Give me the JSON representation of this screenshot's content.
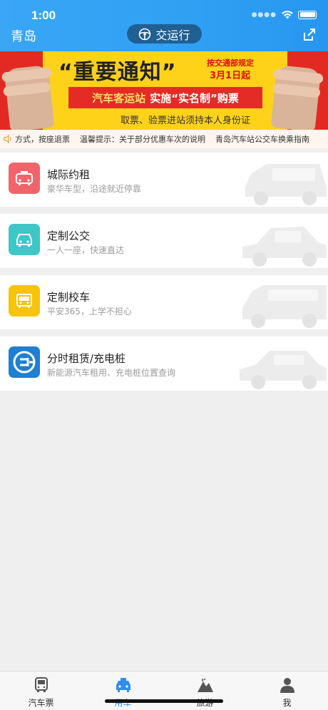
{
  "status_bar": {
    "time": "1:00"
  },
  "header": {
    "city": "青岛",
    "traffic_label": "交运行"
  },
  "banner": {
    "title": "“重要通知”",
    "note_line1": "按交通部规定",
    "note_line2": "3月1日起",
    "ribbon_left": "汽车客运站",
    "ribbon_mid": "实施“实名制”购票",
    "subtitle": "取票、验票进站须持本人身份证"
  },
  "marquee": {
    "items": [
      "方式，按座退票",
      "温馨提示：关于部分优惠车次的说明",
      "青岛汽车站公交车换乘指南"
    ]
  },
  "services": [
    {
      "title": "城际约租",
      "desc": "豪华车型，沿途就近停靠",
      "icon_color": "#f0656b",
      "icon": "taxi-icon"
    },
    {
      "title": "定制公交",
      "desc": "一人一座，快速直达",
      "icon_color": "#3fc6c6",
      "icon": "car-icon"
    },
    {
      "title": "定制校车",
      "desc": "平安365，上学不担心",
      "icon_color": "#f6c40b",
      "icon": "bus-icon"
    },
    {
      "title": "分时租赁/充电桩",
      "desc": "新能源汽车租用、充电桩位置查询",
      "icon_color": "#1f7fd1",
      "icon": "ev-plug-icon"
    }
  ],
  "tabbar": {
    "tabs": [
      {
        "label": "汽车票",
        "icon": "bus-icon"
      },
      {
        "label": "用车",
        "icon": "taxi-icon",
        "active": true
      },
      {
        "label": "旅游",
        "icon": "mountain-icon"
      },
      {
        "label": "我",
        "icon": "user-icon"
      }
    ]
  },
  "colors": {
    "header": "#3aa6f5",
    "active_tab": "#2f8ef0",
    "banner_red": "#e22a23",
    "banner_yellow": "#ffd21a"
  }
}
